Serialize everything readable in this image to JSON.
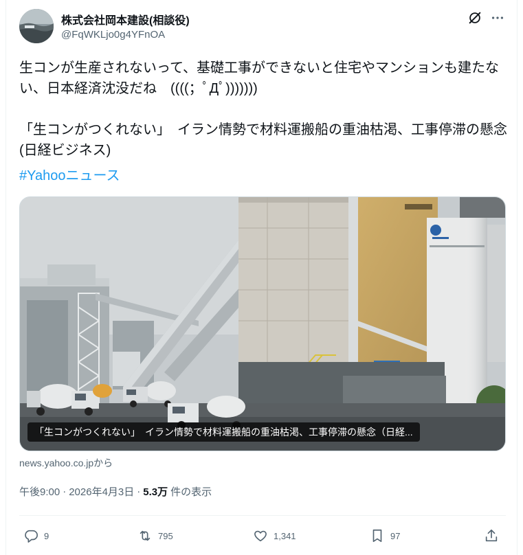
{
  "author": {
    "display_name": "株式会社岡本建設(相談役)",
    "handle": "@FqWKLjo0g4YFnOA",
    "avatar_icon": "avatar-image"
  },
  "header": {
    "grok_icon": "grok-icon",
    "more_icon": "more-dots-icon"
  },
  "post": {
    "text": "生コンが生産されないって、基礎工事ができないと住宅やマンションも建たない、日本経済沈没だね　((((；ﾟДﾟ)))))))\n\n「生コンがつくれない」　イラン情勢で材料運搬船の重油枯渇、工事停滞の懸念(日経ビジネス)",
    "hashtag": "#Yahooニュース"
  },
  "link_card": {
    "caption": "「生コンがつくれない」　イラン情勢で材料運搬船の重油枯渇、工事停滞の懸念（日経...",
    "source": "news.yahoo.co.jpから"
  },
  "meta": {
    "time": "午後9:00",
    "separator1": "·",
    "date": "2026年4月3日",
    "separator2": "·",
    "views_count": "5.3万",
    "views_label": "件の表示"
  },
  "actions": {
    "reply_count": "9",
    "repost_count": "795",
    "like_count": "1,341",
    "bookmark_count": "97"
  },
  "colors": {
    "accent": "#1d9bf0",
    "muted": "#536471",
    "text": "#0f1419",
    "border": "#eff3f4"
  }
}
